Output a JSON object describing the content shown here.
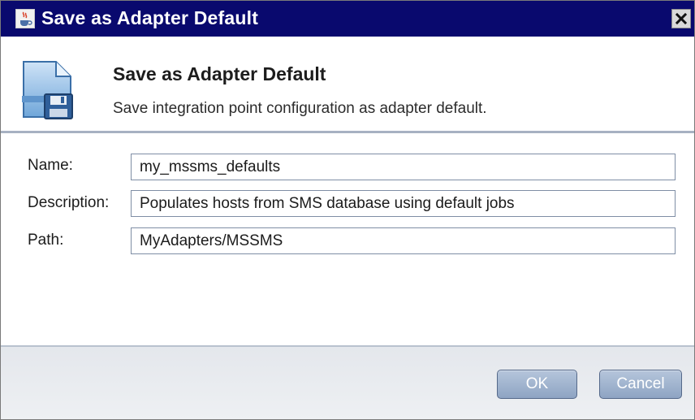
{
  "window": {
    "title": "Save as Adapter Default"
  },
  "header": {
    "title": "Save as Adapter Default",
    "subtitle": "Save integration point configuration as adapter default.",
    "icon": "document-save-icon"
  },
  "form": {
    "fields": [
      {
        "label": "Name:",
        "value": "my_mssms_defaults"
      },
      {
        "label": "Description:",
        "value": "Populates hosts from SMS database using default jobs"
      },
      {
        "label": "Path:",
        "value": "MyAdapters/MSSMS"
      }
    ]
  },
  "buttons": {
    "ok_label": "OK",
    "cancel_label": "Cancel"
  },
  "colors": {
    "titlebar": "#09096e",
    "button": "#9fb3cf",
    "separator": "#a7b1c2"
  }
}
